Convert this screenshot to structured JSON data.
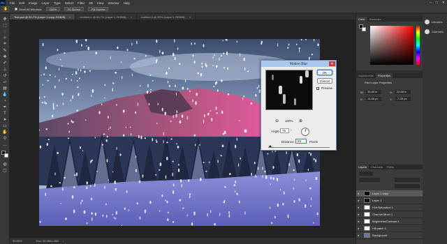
{
  "app": {
    "logo": "Ps"
  },
  "menu": [
    "File",
    "Edit",
    "Image",
    "Layer",
    "Type",
    "Select",
    "Filter",
    "3D",
    "View",
    "Window",
    "Help"
  ],
  "window_controls": {
    "minimize": "–",
    "maximize": "□",
    "close": "✕"
  },
  "options_bar": {
    "tool_icon": "hand-icon",
    "scroll_all_windows": "Scroll All Windows",
    "zoom_button": "100%",
    "fit_screen": "Fit Screen",
    "fill_screen": "Fill Screen"
  },
  "tabs": [
    {
      "label": "Test.psd @ 30.7% (Layer 1 copy, RGB/8)",
      "close": "×"
    },
    {
      "label": "Untitled-1 @ 66.7% (Layer 1, RGB/8)",
      "close": "×"
    },
    {
      "label": "Untitled-2 @ 50% (Layer 1, RGB/8)",
      "close": "×"
    }
  ],
  "statusbar": {
    "zoom": "30.65%",
    "doc": "Doc: 34.9M/1.45G",
    "arrow": "›"
  },
  "dialog": {
    "title": "Motion Blur",
    "close": "✕",
    "ok": "OK",
    "cancel": "Cancel",
    "preview_label": "Preview",
    "preview_checked": true,
    "preview_checkmark": "✓",
    "zoom_value": "100%",
    "zoom_out": "⊖",
    "zoom_in": "⊕",
    "angle_label": "Angle:",
    "angle_value": "75",
    "angle_unit": "°",
    "distance_label": "Distance:",
    "distance_value": "20",
    "distance_unit": "Pixels"
  },
  "color_panel": {
    "tabs": [
      "Color",
      "Swatches"
    ]
  },
  "properties_panel": {
    "tabs": [
      "Adjustments",
      "Properties"
    ],
    "heading": "Pixel Layer Properties",
    "w_label": "W:",
    "w_value": "36.98 in",
    "h_label": "H:",
    "h_value": "24.68 in",
    "x_label": "X:",
    "x_value": "14.06 px",
    "y_label": "Y:",
    "y_value": "-7.05 px"
  },
  "layers_panel": {
    "tabs": [
      "Layers",
      "Channels",
      "Paths"
    ],
    "layers": [
      {
        "name": "Layer 1 copy",
        "selected": true
      },
      {
        "name": "Layer 1",
        "selected": false
      },
      {
        "name": "Hue/Saturation 1",
        "selected": false
      },
      {
        "name": "Channel Mixer 1",
        "selected": false
      },
      {
        "name": "Brightness/Contrast 1",
        "selected": false
      },
      {
        "name": "Hill patch 1",
        "selected": false
      },
      {
        "name": "Background",
        "selected": false
      }
    ],
    "eye": "●"
  },
  "right_strip": [
    {
      "label": "Libraries",
      "icon": "libraries-icon"
    },
    {
      "label": "Channels",
      "icon": "channels-icon"
    }
  ],
  "colors": {
    "accent": "#31a8ff",
    "dialog_title": "#a9c8ee",
    "close_red": "#c9403a"
  }
}
